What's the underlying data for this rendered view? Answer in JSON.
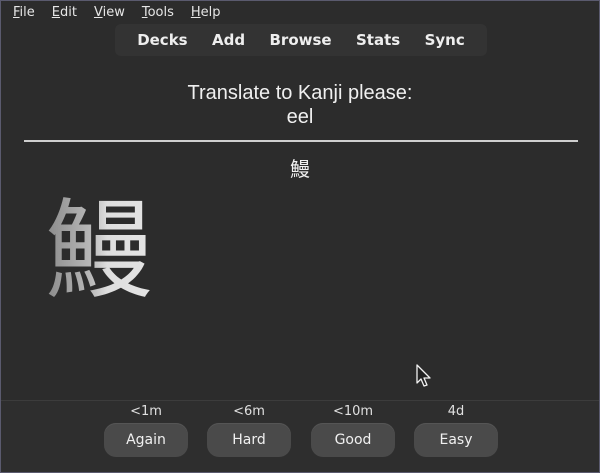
{
  "menu": {
    "items": [
      {
        "accel": "F",
        "rest": "ile"
      },
      {
        "accel": "E",
        "rest": "dit"
      },
      {
        "accel": "V",
        "rest": "iew"
      },
      {
        "accel": "T",
        "rest": "ools"
      },
      {
        "accel": "H",
        "rest": "elp"
      }
    ]
  },
  "toolbar": {
    "decks": "Decks",
    "add": "Add",
    "browse": "Browse",
    "stats": "Stats",
    "sync": "Sync"
  },
  "card": {
    "question_line1": "Translate to Kanji please:",
    "question_line2": "eel",
    "answer_kanji": "鰻",
    "stroke_kanji": "鰻"
  },
  "answer_buttons": [
    {
      "time": "<1m",
      "label": "Again"
    },
    {
      "time": "<6m",
      "label": "Hard"
    },
    {
      "time": "<10m",
      "label": "Good"
    },
    {
      "time": "4d",
      "label": "Easy"
    }
  ],
  "colors": {
    "background": "#2c2c2c",
    "button": "#4a4a4a",
    "divider": "#cfcfcf"
  }
}
